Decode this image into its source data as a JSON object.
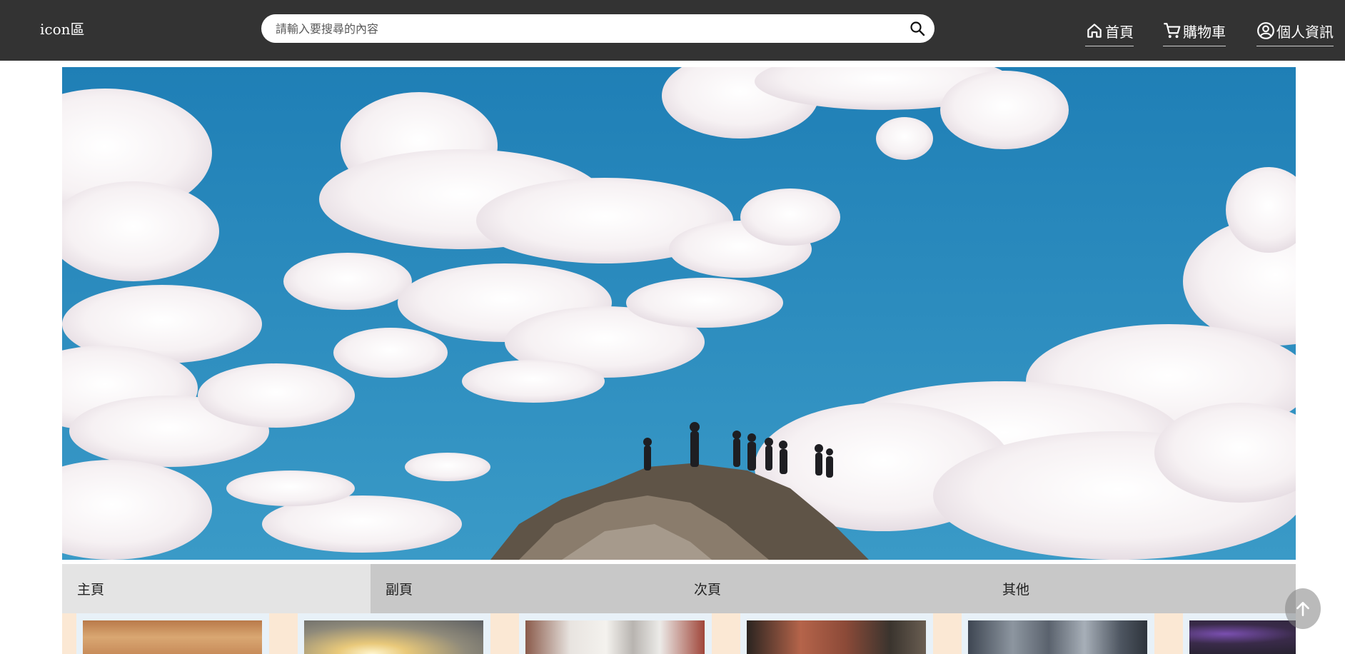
{
  "header": {
    "logo": "icon區",
    "search_placeholder": "請輸入要搜尋的內容",
    "nav": [
      {
        "label": "首頁",
        "icon": "home-icon"
      },
      {
        "label": "購物車",
        "icon": "cart-icon"
      },
      {
        "label": "個人資訊",
        "icon": "account-icon"
      }
    ]
  },
  "hero": {
    "image": "sky-with-clouds-and-people-on-mountain-peak"
  },
  "tabs": [
    {
      "label": "主頁",
      "active": true
    },
    {
      "label": "副頁",
      "active": false
    },
    {
      "label": "次頁",
      "active": false
    },
    {
      "label": "其他",
      "active": false
    }
  ],
  "cards": [
    {
      "image": "warm-blurred-photo"
    },
    {
      "image": "sunset-sky-photo"
    },
    {
      "image": "street-with-trucks-photo"
    },
    {
      "image": "dark-reddish-photo"
    },
    {
      "image": "grey-curtain-photo"
    },
    {
      "image": "dark-purple-photo"
    }
  ],
  "back_to_top": {
    "icon": "arrow-up-icon"
  },
  "colors": {
    "header_bg": "#333333",
    "tab_active": "#e4e4e4",
    "tab_bar": "#c8c8c8",
    "strip_bg": "#fbe8d4",
    "sky": "#2b87b8"
  }
}
